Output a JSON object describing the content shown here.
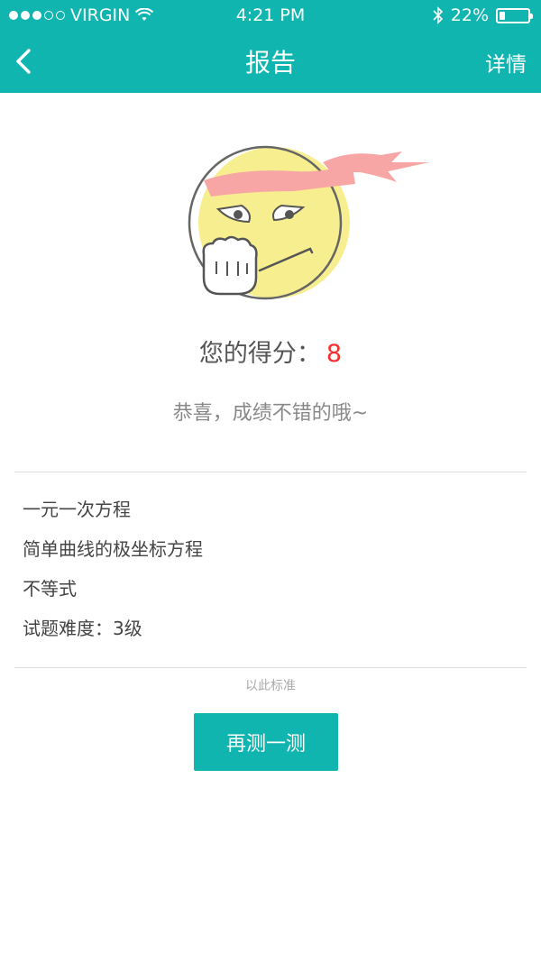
{
  "status_bar": {
    "carrier": "VIRGIN",
    "signal_dots_filled": 3,
    "signal_dots_total": 5,
    "time": "4:21 PM",
    "battery_percent": "22%",
    "battery_level": 0.22
  },
  "nav": {
    "title": "报告",
    "detail_label": "详情",
    "back_icon": "chevron-left-icon"
  },
  "result": {
    "score_label": "您的得分：",
    "score_value": "8",
    "message": "恭喜，成绩不错的哦~"
  },
  "topics": [
    "一元一次方程",
    "简单曲线的极坐标方程",
    "不等式",
    "试题难度：3级"
  ],
  "standard_note": "以此标准",
  "retry_button": "再测一测",
  "colors": {
    "primary": "#0fb5ae",
    "score": "#f2302d",
    "face": "#f7ee8f",
    "headband": "#f7a5a5"
  }
}
